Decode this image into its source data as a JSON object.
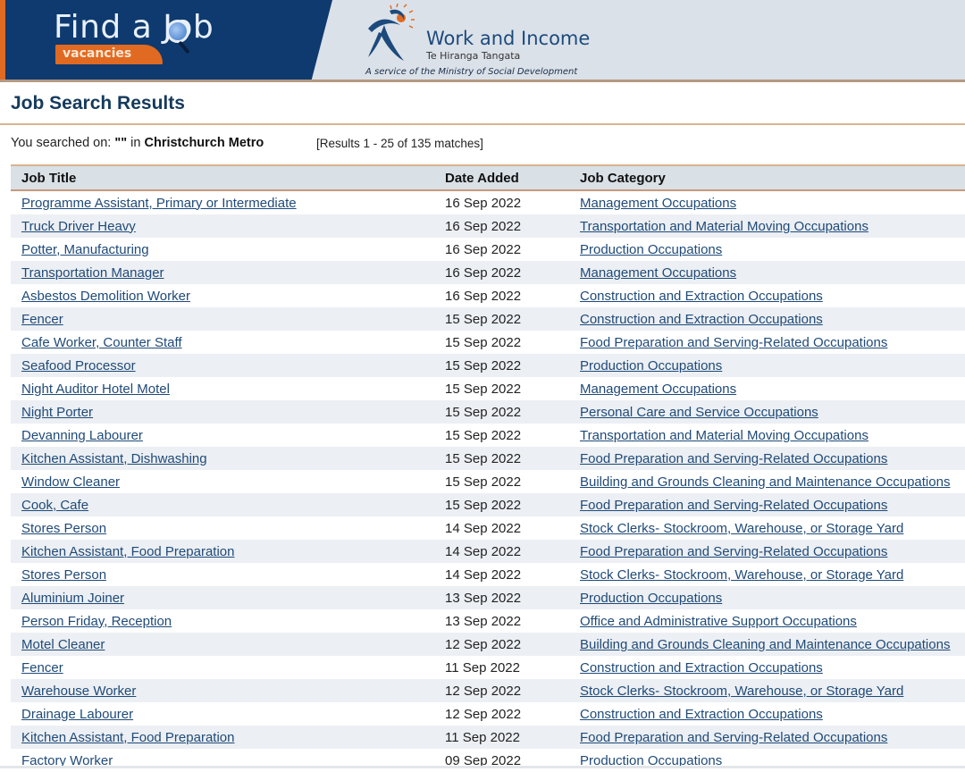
{
  "banner": {
    "findajob_title": "Find a Job",
    "findajob_tagline": "vacancies",
    "agency_name": "Work and Income",
    "agency_subtitle": "Te Hiranga Tangata",
    "agency_service_line": "A service of the Ministry of Social Development",
    "colors": {
      "navy": "#0e3a6f",
      "orange": "#e06a22",
      "light_panel": "#dbe1e8"
    }
  },
  "page": {
    "title": "Job Search Results",
    "search_prefix": "You searched on:",
    "search_term": "\"\"",
    "search_in": "in",
    "search_location": "Christchurch Metro",
    "results_summary": "[Results 1 - 25 of 135 matches]"
  },
  "table": {
    "columns": [
      "Job Title",
      "Date Added",
      "Job Category"
    ],
    "rows": [
      {
        "title": "Programme Assistant, Primary or Intermediate",
        "date": "16 Sep 2022",
        "category": "Management Occupations"
      },
      {
        "title": "Truck Driver Heavy",
        "date": "16 Sep 2022",
        "category": "Transportation and Material Moving Occupations"
      },
      {
        "title": "Potter, Manufacturing",
        "date": "16 Sep 2022",
        "category": "Production Occupations"
      },
      {
        "title": "Transportation Manager",
        "date": "16 Sep 2022",
        "category": "Management Occupations"
      },
      {
        "title": "Asbestos Demolition Worker",
        "date": "16 Sep 2022",
        "category": "Construction and Extraction Occupations"
      },
      {
        "title": "Fencer",
        "date": "15 Sep 2022",
        "category": "Construction and Extraction Occupations"
      },
      {
        "title": "Cafe Worker, Counter Staff",
        "date": "15 Sep 2022",
        "category": "Food Preparation and Serving-Related Occupations"
      },
      {
        "title": "Seafood Processor",
        "date": "15 Sep 2022",
        "category": "Production Occupations"
      },
      {
        "title": "Night Auditor Hotel Motel",
        "date": "15 Sep 2022",
        "category": "Management Occupations"
      },
      {
        "title": "Night Porter",
        "date": "15 Sep 2022",
        "category": "Personal Care and Service Occupations"
      },
      {
        "title": "Devanning Labourer",
        "date": "15 Sep 2022",
        "category": "Transportation and Material Moving Occupations"
      },
      {
        "title": "Kitchen Assistant, Dishwashing",
        "date": "15 Sep 2022",
        "category": "Food Preparation and Serving-Related Occupations"
      },
      {
        "title": "Window Cleaner",
        "date": "15 Sep 2022",
        "category": "Building and Grounds Cleaning and Maintenance Occupations"
      },
      {
        "title": "Cook, Cafe",
        "date": "15 Sep 2022",
        "category": "Food Preparation and Serving-Related Occupations"
      },
      {
        "title": "Stores Person",
        "date": "14 Sep 2022",
        "category": "Stock Clerks- Stockroom, Warehouse, or Storage Yard"
      },
      {
        "title": "Kitchen Assistant, Food Preparation",
        "date": "14 Sep 2022",
        "category": "Food Preparation and Serving-Related Occupations"
      },
      {
        "title": "Stores Person",
        "date": "14 Sep 2022",
        "category": "Stock Clerks- Stockroom, Warehouse, or Storage Yard"
      },
      {
        "title": "Aluminium Joiner",
        "date": "13 Sep 2022",
        "category": "Production Occupations"
      },
      {
        "title": "Person Friday, Reception",
        "date": "13 Sep 2022",
        "category": "Office and Administrative Support Occupations"
      },
      {
        "title": "Motel Cleaner",
        "date": "12 Sep 2022",
        "category": "Building and Grounds Cleaning and Maintenance Occupations"
      },
      {
        "title": "Fencer",
        "date": "11 Sep 2022",
        "category": "Construction and Extraction Occupations"
      },
      {
        "title": "Warehouse Worker",
        "date": "12 Sep 2022",
        "category": "Stock Clerks- Stockroom, Warehouse, or Storage Yard"
      },
      {
        "title": "Drainage Labourer",
        "date": "12 Sep 2022",
        "category": "Construction and Extraction Occupations"
      },
      {
        "title": "Kitchen Assistant, Food Preparation",
        "date": "11 Sep 2022",
        "category": "Food Preparation and Serving-Related Occupations"
      },
      {
        "title": "Factory Worker",
        "date": "09 Sep 2022",
        "category": "Production Occupations"
      }
    ]
  }
}
